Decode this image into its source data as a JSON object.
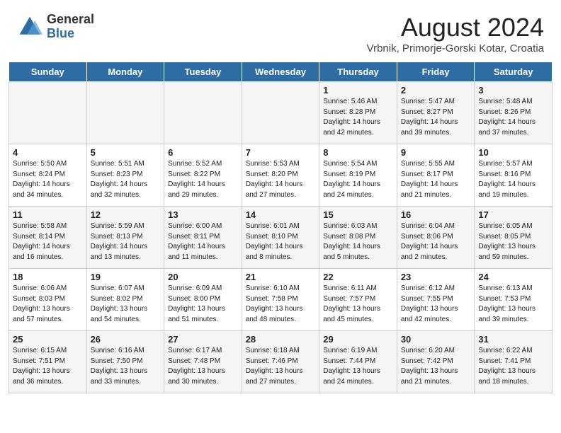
{
  "header": {
    "logo_general": "General",
    "logo_blue": "Blue",
    "month_title": "August 2024",
    "subtitle": "Vrbnik, Primorje-Gorski Kotar, Croatia"
  },
  "days_of_week": [
    "Sunday",
    "Monday",
    "Tuesday",
    "Wednesday",
    "Thursday",
    "Friday",
    "Saturday"
  ],
  "weeks": [
    [
      {
        "day": "",
        "info": ""
      },
      {
        "day": "",
        "info": ""
      },
      {
        "day": "",
        "info": ""
      },
      {
        "day": "",
        "info": ""
      },
      {
        "day": "1",
        "info": "Sunrise: 5:46 AM\nSunset: 8:28 PM\nDaylight: 14 hours\nand 42 minutes."
      },
      {
        "day": "2",
        "info": "Sunrise: 5:47 AM\nSunset: 8:27 PM\nDaylight: 14 hours\nand 39 minutes."
      },
      {
        "day": "3",
        "info": "Sunrise: 5:48 AM\nSunset: 8:26 PM\nDaylight: 14 hours\nand 37 minutes."
      }
    ],
    [
      {
        "day": "4",
        "info": "Sunrise: 5:50 AM\nSunset: 8:24 PM\nDaylight: 14 hours\nand 34 minutes."
      },
      {
        "day": "5",
        "info": "Sunrise: 5:51 AM\nSunset: 8:23 PM\nDaylight: 14 hours\nand 32 minutes."
      },
      {
        "day": "6",
        "info": "Sunrise: 5:52 AM\nSunset: 8:22 PM\nDaylight: 14 hours\nand 29 minutes."
      },
      {
        "day": "7",
        "info": "Sunrise: 5:53 AM\nSunset: 8:20 PM\nDaylight: 14 hours\nand 27 minutes."
      },
      {
        "day": "8",
        "info": "Sunrise: 5:54 AM\nSunset: 8:19 PM\nDaylight: 14 hours\nand 24 minutes."
      },
      {
        "day": "9",
        "info": "Sunrise: 5:55 AM\nSunset: 8:17 PM\nDaylight: 14 hours\nand 21 minutes."
      },
      {
        "day": "10",
        "info": "Sunrise: 5:57 AM\nSunset: 8:16 PM\nDaylight: 14 hours\nand 19 minutes."
      }
    ],
    [
      {
        "day": "11",
        "info": "Sunrise: 5:58 AM\nSunset: 8:14 PM\nDaylight: 14 hours\nand 16 minutes."
      },
      {
        "day": "12",
        "info": "Sunrise: 5:59 AM\nSunset: 8:13 PM\nDaylight: 14 hours\nand 13 minutes."
      },
      {
        "day": "13",
        "info": "Sunrise: 6:00 AM\nSunset: 8:11 PM\nDaylight: 14 hours\nand 11 minutes."
      },
      {
        "day": "14",
        "info": "Sunrise: 6:01 AM\nSunset: 8:10 PM\nDaylight: 14 hours\nand 8 minutes."
      },
      {
        "day": "15",
        "info": "Sunrise: 6:03 AM\nSunset: 8:08 PM\nDaylight: 14 hours\nand 5 minutes."
      },
      {
        "day": "16",
        "info": "Sunrise: 6:04 AM\nSunset: 8:06 PM\nDaylight: 14 hours\nand 2 minutes."
      },
      {
        "day": "17",
        "info": "Sunrise: 6:05 AM\nSunset: 8:05 PM\nDaylight: 13 hours\nand 59 minutes."
      }
    ],
    [
      {
        "day": "18",
        "info": "Sunrise: 6:06 AM\nSunset: 8:03 PM\nDaylight: 13 hours\nand 57 minutes."
      },
      {
        "day": "19",
        "info": "Sunrise: 6:07 AM\nSunset: 8:02 PM\nDaylight: 13 hours\nand 54 minutes."
      },
      {
        "day": "20",
        "info": "Sunrise: 6:09 AM\nSunset: 8:00 PM\nDaylight: 13 hours\nand 51 minutes."
      },
      {
        "day": "21",
        "info": "Sunrise: 6:10 AM\nSunset: 7:58 PM\nDaylight: 13 hours\nand 48 minutes."
      },
      {
        "day": "22",
        "info": "Sunrise: 6:11 AM\nSunset: 7:57 PM\nDaylight: 13 hours\nand 45 minutes."
      },
      {
        "day": "23",
        "info": "Sunrise: 6:12 AM\nSunset: 7:55 PM\nDaylight: 13 hours\nand 42 minutes."
      },
      {
        "day": "24",
        "info": "Sunrise: 6:13 AM\nSunset: 7:53 PM\nDaylight: 13 hours\nand 39 minutes."
      }
    ],
    [
      {
        "day": "25",
        "info": "Sunrise: 6:15 AM\nSunset: 7:51 PM\nDaylight: 13 hours\nand 36 minutes."
      },
      {
        "day": "26",
        "info": "Sunrise: 6:16 AM\nSunset: 7:50 PM\nDaylight: 13 hours\nand 33 minutes."
      },
      {
        "day": "27",
        "info": "Sunrise: 6:17 AM\nSunset: 7:48 PM\nDaylight: 13 hours\nand 30 minutes."
      },
      {
        "day": "28",
        "info": "Sunrise: 6:18 AM\nSunset: 7:46 PM\nDaylight: 13 hours\nand 27 minutes."
      },
      {
        "day": "29",
        "info": "Sunrise: 6:19 AM\nSunset: 7:44 PM\nDaylight: 13 hours\nand 24 minutes."
      },
      {
        "day": "30",
        "info": "Sunrise: 6:20 AM\nSunset: 7:42 PM\nDaylight: 13 hours\nand 21 minutes."
      },
      {
        "day": "31",
        "info": "Sunrise: 6:22 AM\nSunset: 7:41 PM\nDaylight: 13 hours\nand 18 minutes."
      }
    ]
  ]
}
